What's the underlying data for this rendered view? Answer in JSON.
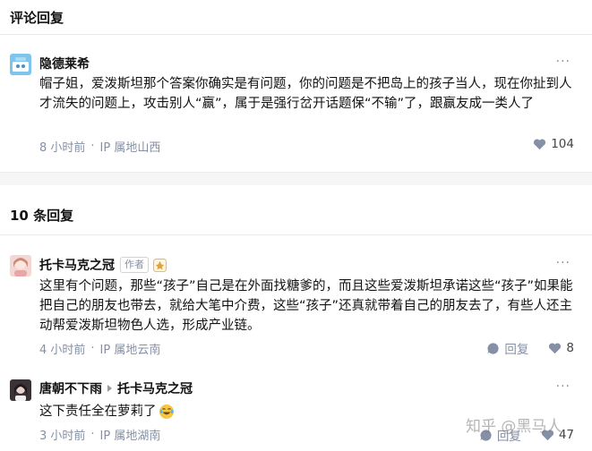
{
  "top_section": {
    "title": "评论回复"
  },
  "main_comment": {
    "author": "隐德莱希",
    "text": "帽子姐，爱泼斯坦那个答案你确实是有问题，你的问题是不把岛上的孩子当人，现在你扯到人才流失的问题上，攻击别人“赢”，属于是强行岔开话题保“不输”了，跟赢友成一类人了",
    "time": "8 小时前",
    "ip": "IP 属地山西",
    "likes": "104",
    "more": "···"
  },
  "replies_section": {
    "title": "10 条回复"
  },
  "replies": [
    {
      "author": "托卡马克之冠",
      "author_tag": "作者",
      "text": "这里有个问题，那些“孩子”自己是在外面找糖爹的，而且这些爱泼斯坦承诺这些“孩子”如果能把自己的朋友也带去，就给大笔中介费，这些“孩子”还真就带着自己的朋友去了，有些人还主动帮爱泼斯坦物色人选，形成产业链。",
      "time": "4 小时前",
      "ip": "IP 属地云南",
      "reply_label": "回复",
      "likes": "8",
      "more": "···"
    },
    {
      "author": "唐朝不下雨",
      "reply_to": "托卡马克之冠",
      "text": "这下责任全在萝莉了",
      "time": "3 小时前",
      "ip": "IP 属地湖南",
      "reply_label": "回复",
      "likes": "47",
      "more": "···"
    }
  ],
  "watermark": "知乎 @黑马人",
  "colors": {
    "accent_badge": "#d9a441",
    "meta": "#8590a6",
    "band": "#f6f6f6"
  }
}
